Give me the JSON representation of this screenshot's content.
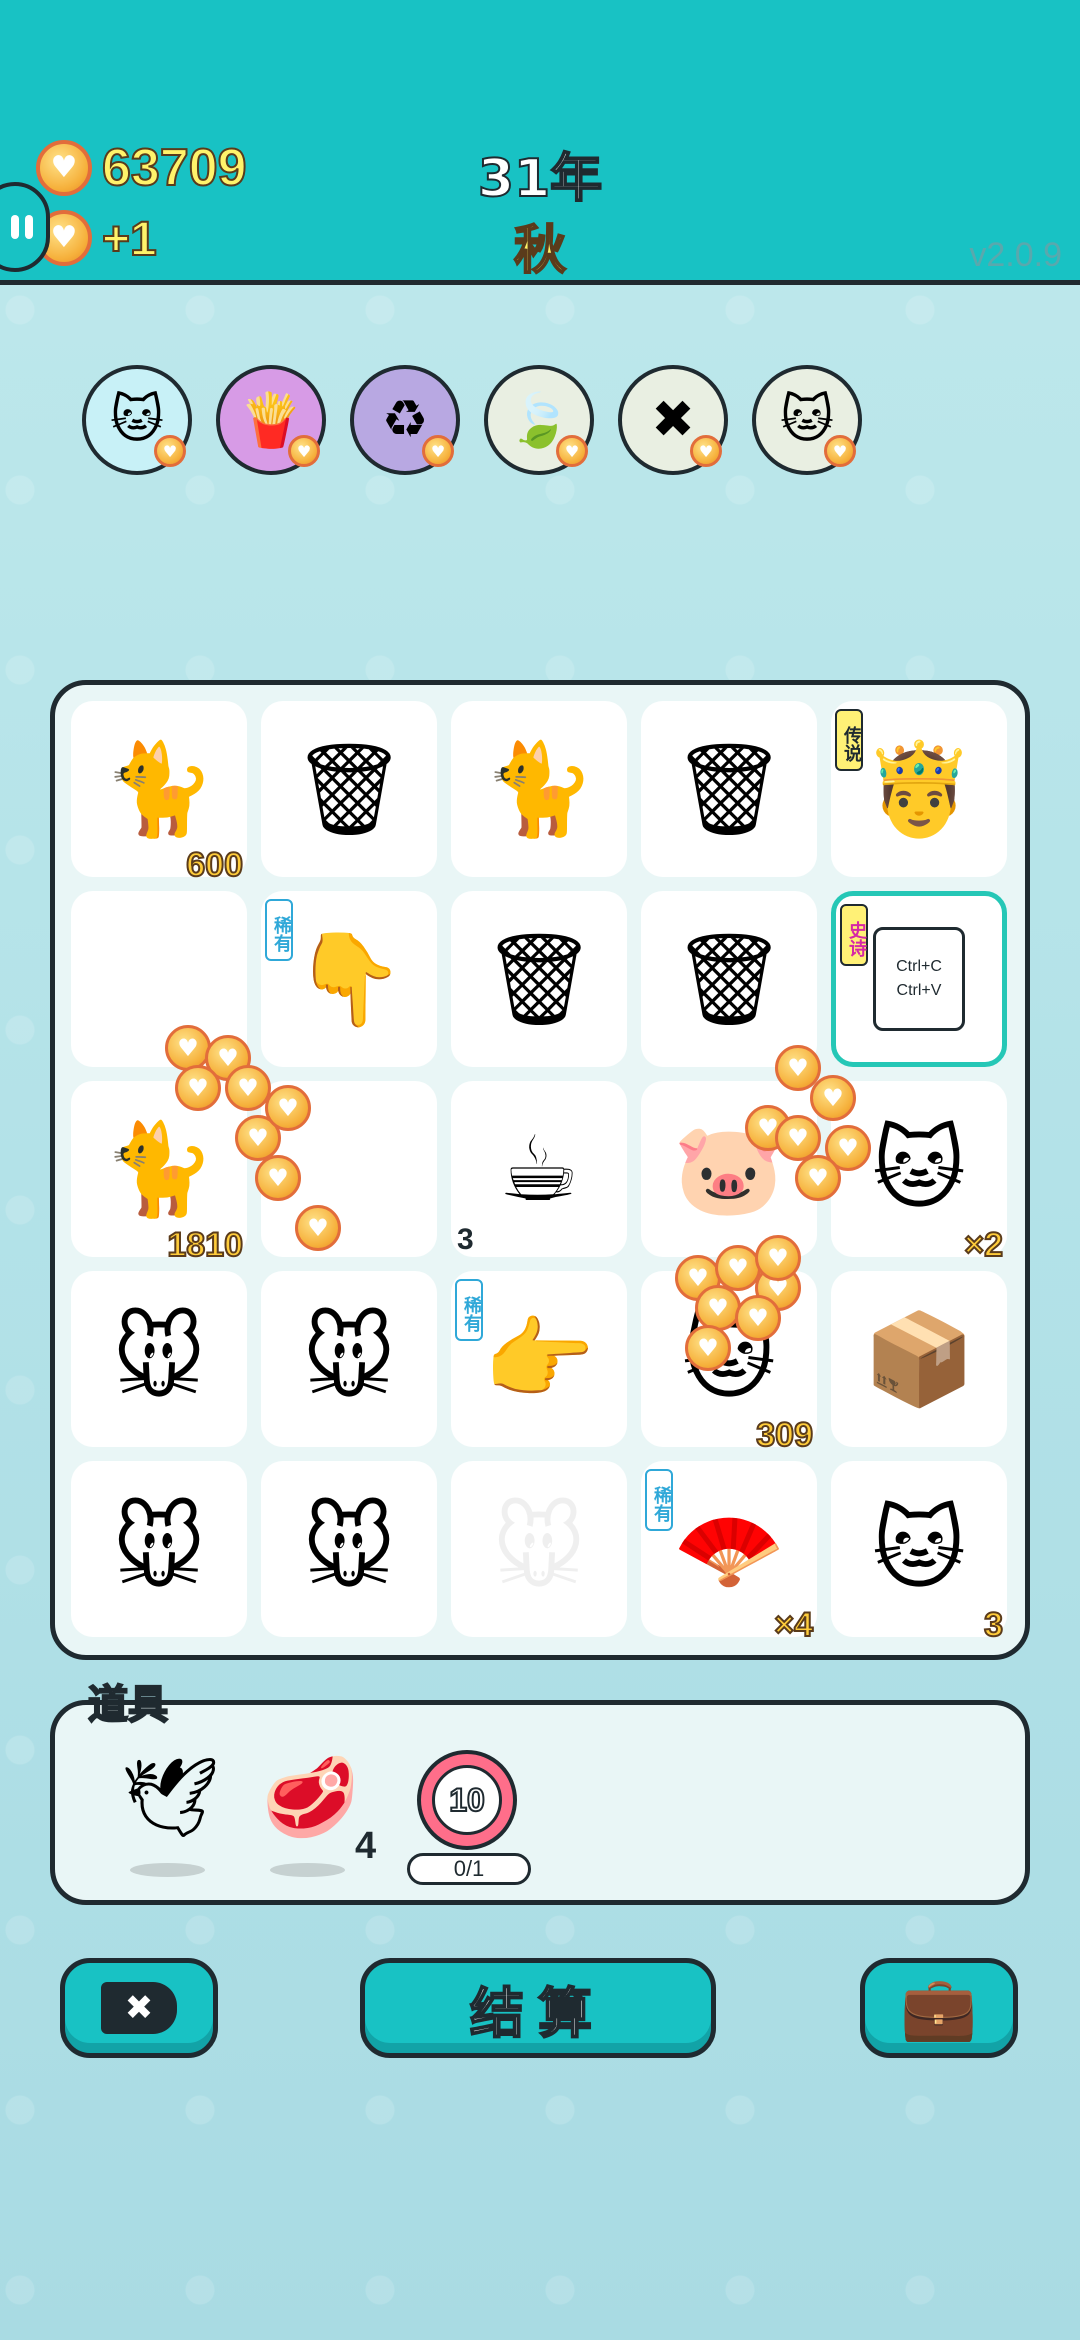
{
  "header": {
    "money": "63709",
    "income": "+1",
    "year": "31年",
    "season": "秋",
    "version": "v2.0.9"
  },
  "buffs": [
    {
      "icon": "cat-buff-icon",
      "glyph": "🐱",
      "bg": "#c8f1f7"
    },
    {
      "icon": "fries-icon",
      "glyph": "🍟",
      "bg": "#d79be6"
    },
    {
      "icon": "recycle-icon",
      "glyph": "♻",
      "bg": "#b8a8e2"
    },
    {
      "icon": "leaf-icon",
      "glyph": "🍃",
      "bg": "#e9efe2"
    },
    {
      "icon": "remove-tag-icon",
      "glyph": "✖",
      "bg": "#e9efe2"
    },
    {
      "icon": "cats-icon",
      "glyph": "🐱",
      "bg": "#e9efe2"
    }
  ],
  "board": [
    {
      "r": 0,
      "c": 0,
      "name": "orange-cat",
      "glyph": "🐈",
      "num": "600"
    },
    {
      "r": 0,
      "c": 1,
      "name": "garbage-bag",
      "glyph": "🗑",
      "num": ""
    },
    {
      "r": 0,
      "c": 2,
      "name": "orange-cat",
      "glyph": "🐈",
      "num": ""
    },
    {
      "r": 0,
      "c": 3,
      "name": "garbage-bag",
      "glyph": "🗑",
      "num": ""
    },
    {
      "r": 0,
      "c": 4,
      "name": "king",
      "glyph": "🤴",
      "num": "",
      "tag": "传说",
      "tagType": "legend"
    },
    {
      "r": 1,
      "c": 0,
      "name": "empty",
      "glyph": "",
      "num": ""
    },
    {
      "r": 1,
      "c": 1,
      "name": "pointing-hand-down",
      "glyph": "👇",
      "num": "",
      "tag": "稀有",
      "tagType": "rare"
    },
    {
      "r": 1,
      "c": 2,
      "name": "garbage-bag",
      "glyph": "🗑",
      "num": ""
    },
    {
      "r": 1,
      "c": 3,
      "name": "garbage-bag",
      "glyph": "🗑",
      "num": ""
    },
    {
      "r": 1,
      "c": 4,
      "name": "ctrl-card",
      "glyph": "",
      "num": "",
      "tag": "史诗",
      "tagType": "epic",
      "card": [
        "Ctrl+C",
        "Ctrl+V"
      ],
      "selected": true
    },
    {
      "r": 2,
      "c": 0,
      "name": "orange-cat",
      "glyph": "🐈",
      "num": "1810"
    },
    {
      "r": 2,
      "c": 1,
      "name": "empty",
      "glyph": "",
      "num": ""
    },
    {
      "r": 2,
      "c": 2,
      "name": "coffee-cup",
      "glyph": "☕",
      "num": "3",
      "numLeft": true
    },
    {
      "r": 2,
      "c": 3,
      "name": "pig",
      "glyph": "🐷",
      "num": ""
    },
    {
      "r": 2,
      "c": 4,
      "name": "black-face-cat",
      "glyph": "🐱",
      "num": "×2"
    },
    {
      "r": 3,
      "c": 0,
      "name": "mouse",
      "glyph": "🐭",
      "num": ""
    },
    {
      "r": 3,
      "c": 1,
      "name": "mouse",
      "glyph": "🐭",
      "num": ""
    },
    {
      "r": 3,
      "c": 2,
      "name": "pointing-hand",
      "glyph": "👉",
      "num": "",
      "tag": "稀有",
      "tagType": "rare"
    },
    {
      "r": 3,
      "c": 3,
      "name": "coin-cat",
      "glyph": "🐱",
      "num": "309"
    },
    {
      "r": 3,
      "c": 4,
      "name": "package-box",
      "glyph": "📦",
      "num": ""
    },
    {
      "r": 4,
      "c": 0,
      "name": "mouse",
      "glyph": "🐭",
      "num": ""
    },
    {
      "r": 4,
      "c": 1,
      "name": "mouse",
      "glyph": "🐭",
      "num": ""
    },
    {
      "r": 4,
      "c": 2,
      "name": "faded-mouse",
      "glyph": "🐭",
      "num": "",
      "faded": true
    },
    {
      "r": 4,
      "c": 3,
      "name": "fan",
      "glyph": "🪭",
      "num": "×4",
      "tag": "稀有",
      "tagType": "rare"
    },
    {
      "r": 4,
      "c": 4,
      "name": "black-face-cat",
      "glyph": "🐱",
      "num": "3"
    }
  ],
  "items": {
    "label": "道具",
    "bird_glyph": "🕊",
    "meat_glyph": "🥩",
    "meat_count": "4",
    "timer_value": "10",
    "timer_progress": "0/1"
  },
  "buttons": {
    "remove_glyph": "✖",
    "settle_label": "结算",
    "bag_glyph": "💼"
  },
  "colors": {
    "topbar": "#18c2c4",
    "accent": "#18c2c4",
    "coin": "#f6b13c",
    "outline": "#1f2a30"
  }
}
